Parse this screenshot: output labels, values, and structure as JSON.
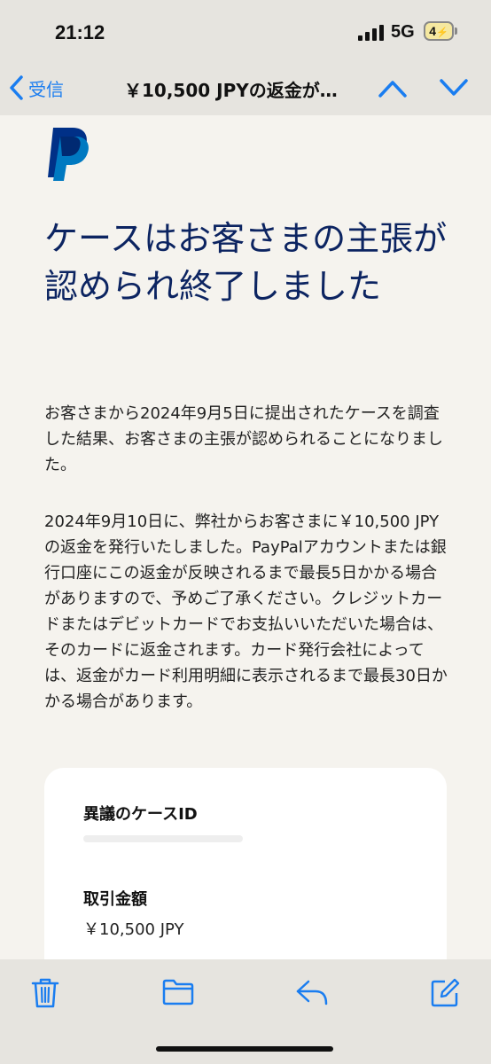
{
  "status": {
    "time": "21:12",
    "network": "5G",
    "battery": "4"
  },
  "nav": {
    "back_label": "受信",
    "title": "￥10,500 JPYの返金が…"
  },
  "email": {
    "headline": "ケースはお客さまの主張が認められ終了しました",
    "paragraph1": "お客さまから2024年9月5日に提出されたケースを調査した結果、お客さまの主張が認められることになりました。",
    "paragraph2": "2024年9月10日に、弊社からお客さまに￥10,500 JPYの返金を発行いたしました。PayPalアカウントまたは銀行口座にこの返金が反映されるまで最長5日かかる場合がありますので、予めご了承ください。クレジットカードまたはデビットカードでお支払いいただいた場合は、そのカードに返金されます。カード発行会社によっては、返金がカード利用明細に表示されるまで最長30日かかる場合があります。",
    "details": {
      "case_id_label": "異議のケースID",
      "amount_label": "取引金額",
      "amount_value": "￥10,500 JPY"
    }
  },
  "icons": {
    "back": "chevron-left-icon",
    "prev": "chevron-up-icon",
    "next": "chevron-down-icon",
    "logo": "paypal-logo",
    "trash": "trash-icon",
    "folder": "folder-icon",
    "reply": "reply-icon",
    "compose": "compose-icon"
  },
  "colors": {
    "accent": "#1a7df0",
    "headline": "#0c2461",
    "paypal_dark": "#003087",
    "paypal_light": "#0079c1",
    "bar_bg": "#e6e4df",
    "page_bg": "#f5f3ee"
  }
}
